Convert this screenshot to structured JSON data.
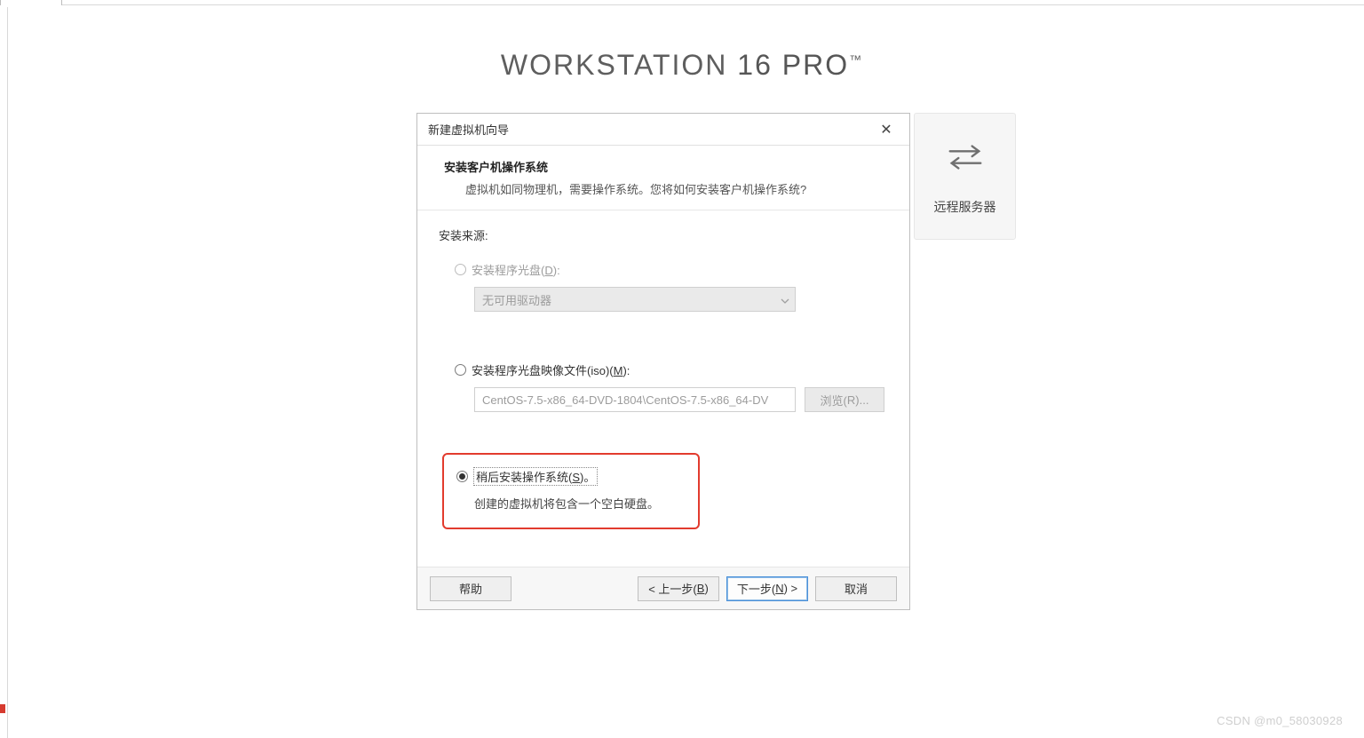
{
  "brand": {
    "name_a": "WORKSTATION",
    "name_b": "16 PRO",
    "tm": "™"
  },
  "bg_tile": {
    "label": "远程服务器"
  },
  "dialog": {
    "title": "新建虚拟机向导",
    "close_glyph": "✕",
    "header_title": "安装客户机操作系统",
    "header_sub": "虚拟机如同物理机，需要操作系统。您将如何安装客户机操作系统?",
    "section_label": "安装来源:",
    "opt_disc_pre": "安装程序光盘(",
    "opt_disc_key": "D",
    "opt_disc_post": "):",
    "disc_combo": "无可用驱动器",
    "opt_iso_pre": "安装程序光盘映像文件(iso)(",
    "opt_iso_key": "M",
    "opt_iso_post": "):",
    "iso_path": "CentOS-7.5-x86_64-DVD-1804\\CentOS-7.5-x86_64-DV",
    "browse_pre": "浏览(",
    "browse_key": "R",
    "browse_post": ")...",
    "opt_later_pre": "稍后安装操作系统(",
    "opt_later_key": "S",
    "opt_later_post": ")。",
    "later_desc": "创建的虚拟机将包含一个空白硬盘。",
    "btn_help": "帮助",
    "btn_back_pre": "< 上一步(",
    "btn_back_key": "B",
    "btn_back_post": ")",
    "btn_next_pre": "下一步(",
    "btn_next_key": "N",
    "btn_next_post": ") >",
    "btn_cancel": "取消"
  },
  "watermark": "CSDN @m0_58030928"
}
